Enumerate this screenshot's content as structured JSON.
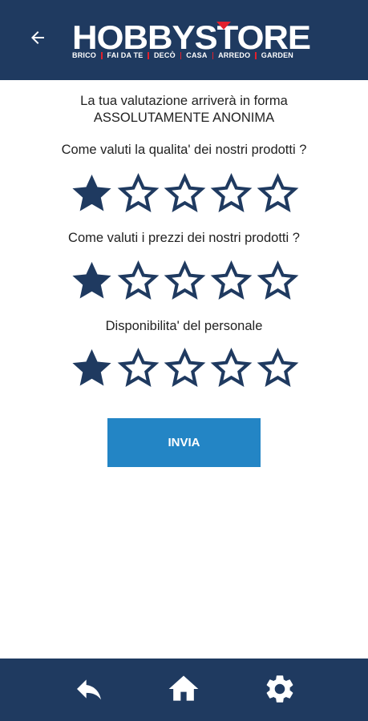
{
  "header": {
    "back_icon": "arrow-left-icon",
    "logo": {
      "wordmark": "HOBBYSTORE",
      "tags": [
        "BRICO",
        "FAI DA TE",
        "DECÒ",
        "CASA",
        "ARREDO",
        "GARDEN"
      ]
    }
  },
  "intro": {
    "line1": "La tua valutazione arriverà in forma",
    "line2": "ASSOLUTAMENTE ANONIMA"
  },
  "questions": [
    {
      "label": "Come valuti la qualita' dei nostri prodotti ?",
      "rating": 1,
      "max": 5
    },
    {
      "label": "Come valuti i prezzi dei nostri prodotti ?",
      "rating": 1,
      "max": 5
    },
    {
      "label": "Disponibilita' del personale",
      "rating": 1,
      "max": 5
    }
  ],
  "submit_label": "INVIA",
  "footer": {
    "items": [
      {
        "icon": "reply-icon"
      },
      {
        "icon": "home-icon"
      },
      {
        "icon": "settings-gear-icon"
      }
    ]
  },
  "colors": {
    "brand_navy": "#1f3a60",
    "accent_blue": "#2385c5",
    "logo_red": "#e2202c",
    "star": "#1f3a60"
  }
}
